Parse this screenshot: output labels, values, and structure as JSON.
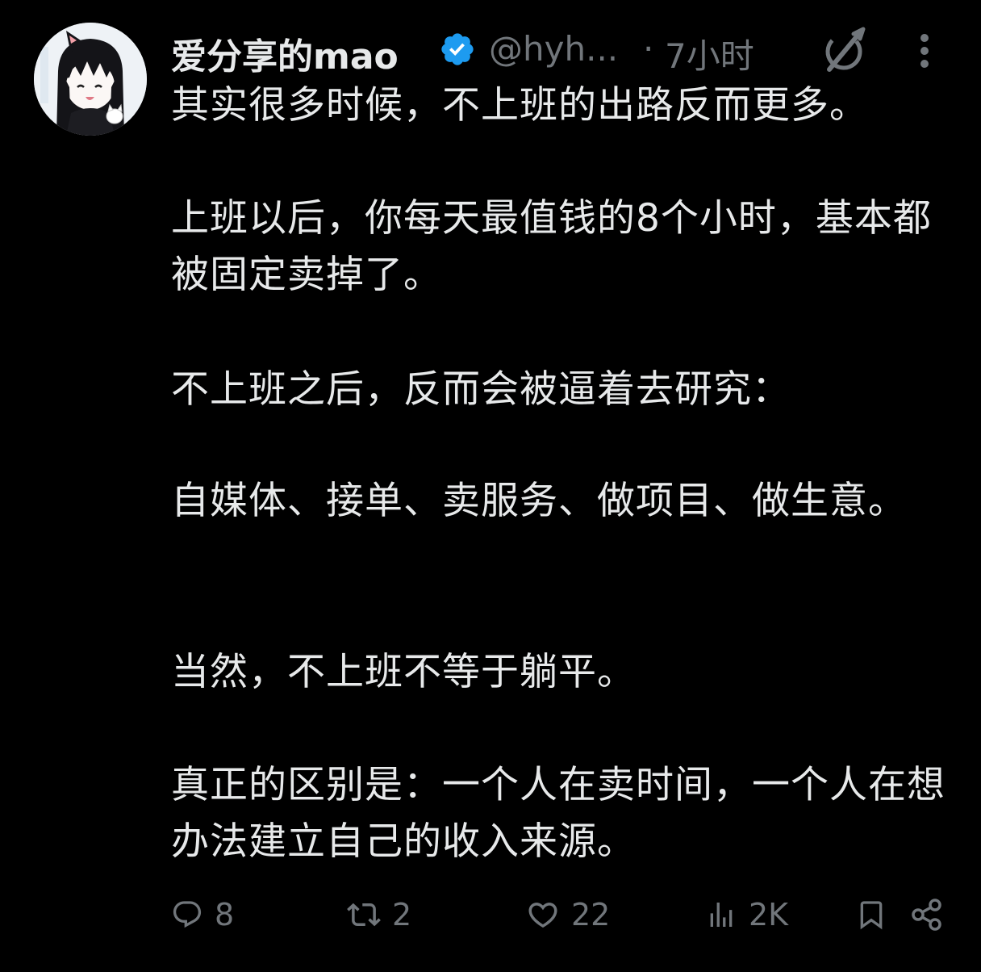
{
  "tweet": {
    "author": {
      "display_name": "爱分享的mao",
      "handle": "@hyh...",
      "avatar_icon": "anime-girl-avatar",
      "verified_icon": "verified-badge-icon"
    },
    "separator": "·",
    "timestamp": "7小时",
    "header_icons": [
      "grok-icon",
      "more-vertical-icon"
    ],
    "paragraphs": [
      "其实很多时候，不上班的出路反而更多。",
      "上班以后，你每天最值钱的8个小时，基本都被固定卖掉了。",
      "不上班之后，反而会被逼着去研究：",
      "自媒体、接单、卖服务、做项目、做生意。",
      "当然，不上班不等于躺平。",
      "真正的区别是：一个人在卖时间，一个人在想办法建立自己的收入来源。"
    ],
    "actions": {
      "reply": {
        "icon": "reply-icon",
        "count": "8"
      },
      "repost": {
        "icon": "repost-icon",
        "count": "2"
      },
      "like": {
        "icon": "heart-icon",
        "count": "22"
      },
      "views": {
        "icon": "views-icon",
        "count": "2K"
      },
      "bookmark": {
        "icon": "bookmark-icon"
      },
      "share": {
        "icon": "share-icon"
      }
    }
  },
  "colors": {
    "background": "#000000",
    "text_primary": "#e7e9ea",
    "text_secondary": "#71767b",
    "verified_blue": "#1d9bf0"
  }
}
